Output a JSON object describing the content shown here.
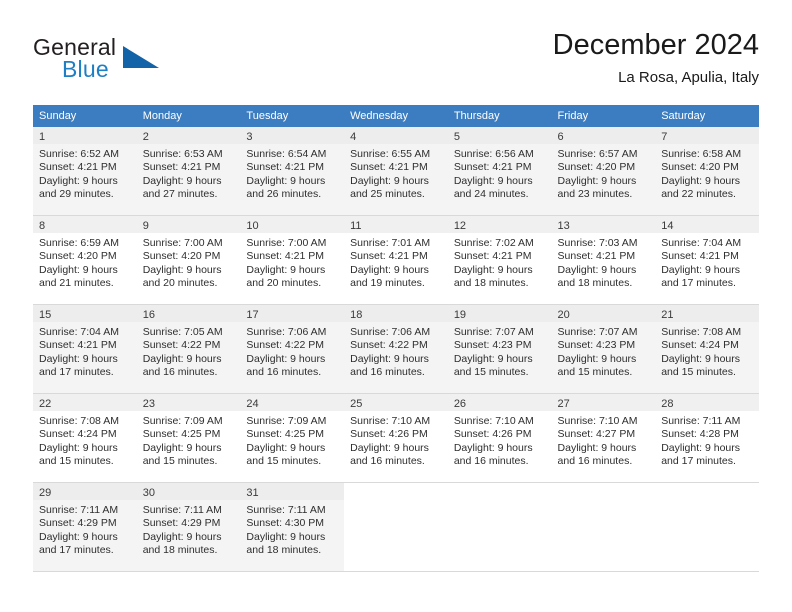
{
  "brand": {
    "name_part1": "General",
    "name_part2": "Blue",
    "logo_icon": "blue-triangle-logo"
  },
  "header": {
    "month_title": "December 2024",
    "location": "La Rosa, Apulia, Italy"
  },
  "colors": {
    "header_blue": "#3b7dc0",
    "brand_blue": "#1f7fc4",
    "row_shade": "#f4f4f4",
    "daynum_band": "#ededed",
    "grid_line": "#d9d9d9"
  },
  "weekday_headers": [
    "Sunday",
    "Monday",
    "Tuesday",
    "Wednesday",
    "Thursday",
    "Friday",
    "Saturday"
  ],
  "labels": {
    "sunrise_prefix": "Sunrise: ",
    "sunset_prefix": "Sunset: ",
    "daylight_prefix": "Daylight: "
  },
  "weeks": [
    {
      "shaded": true,
      "days": [
        {
          "day": "1",
          "sunrise": "Sunrise: 6:52 AM",
          "sunset": "Sunset: 4:21 PM",
          "daylight_line1": "Daylight: 9 hours",
          "daylight_line2": "and 29 minutes."
        },
        {
          "day": "2",
          "sunrise": "Sunrise: 6:53 AM",
          "sunset": "Sunset: 4:21 PM",
          "daylight_line1": "Daylight: 9 hours",
          "daylight_line2": "and 27 minutes."
        },
        {
          "day": "3",
          "sunrise": "Sunrise: 6:54 AM",
          "sunset": "Sunset: 4:21 PM",
          "daylight_line1": "Daylight: 9 hours",
          "daylight_line2": "and 26 minutes."
        },
        {
          "day": "4",
          "sunrise": "Sunrise: 6:55 AM",
          "sunset": "Sunset: 4:21 PM",
          "daylight_line1": "Daylight: 9 hours",
          "daylight_line2": "and 25 minutes."
        },
        {
          "day": "5",
          "sunrise": "Sunrise: 6:56 AM",
          "sunset": "Sunset: 4:21 PM",
          "daylight_line1": "Daylight: 9 hours",
          "daylight_line2": "and 24 minutes."
        },
        {
          "day": "6",
          "sunrise": "Sunrise: 6:57 AM",
          "sunset": "Sunset: 4:20 PM",
          "daylight_line1": "Daylight: 9 hours",
          "daylight_line2": "and 23 minutes."
        },
        {
          "day": "7",
          "sunrise": "Sunrise: 6:58 AM",
          "sunset": "Sunset: 4:20 PM",
          "daylight_line1": "Daylight: 9 hours",
          "daylight_line2": "and 22 minutes."
        }
      ]
    },
    {
      "shaded": false,
      "days": [
        {
          "day": "8",
          "sunrise": "Sunrise: 6:59 AM",
          "sunset": "Sunset: 4:20 PM",
          "daylight_line1": "Daylight: 9 hours",
          "daylight_line2": "and 21 minutes."
        },
        {
          "day": "9",
          "sunrise": "Sunrise: 7:00 AM",
          "sunset": "Sunset: 4:20 PM",
          "daylight_line1": "Daylight: 9 hours",
          "daylight_line2": "and 20 minutes."
        },
        {
          "day": "10",
          "sunrise": "Sunrise: 7:00 AM",
          "sunset": "Sunset: 4:21 PM",
          "daylight_line1": "Daylight: 9 hours",
          "daylight_line2": "and 20 minutes."
        },
        {
          "day": "11",
          "sunrise": "Sunrise: 7:01 AM",
          "sunset": "Sunset: 4:21 PM",
          "daylight_line1": "Daylight: 9 hours",
          "daylight_line2": "and 19 minutes."
        },
        {
          "day": "12",
          "sunrise": "Sunrise: 7:02 AM",
          "sunset": "Sunset: 4:21 PM",
          "daylight_line1": "Daylight: 9 hours",
          "daylight_line2": "and 18 minutes."
        },
        {
          "day": "13",
          "sunrise": "Sunrise: 7:03 AM",
          "sunset": "Sunset: 4:21 PM",
          "daylight_line1": "Daylight: 9 hours",
          "daylight_line2": "and 18 minutes."
        },
        {
          "day": "14",
          "sunrise": "Sunrise: 7:04 AM",
          "sunset": "Sunset: 4:21 PM",
          "daylight_line1": "Daylight: 9 hours",
          "daylight_line2": "and 17 minutes."
        }
      ]
    },
    {
      "shaded": true,
      "days": [
        {
          "day": "15",
          "sunrise": "Sunrise: 7:04 AM",
          "sunset": "Sunset: 4:21 PM",
          "daylight_line1": "Daylight: 9 hours",
          "daylight_line2": "and 17 minutes."
        },
        {
          "day": "16",
          "sunrise": "Sunrise: 7:05 AM",
          "sunset": "Sunset: 4:22 PM",
          "daylight_line1": "Daylight: 9 hours",
          "daylight_line2": "and 16 minutes."
        },
        {
          "day": "17",
          "sunrise": "Sunrise: 7:06 AM",
          "sunset": "Sunset: 4:22 PM",
          "daylight_line1": "Daylight: 9 hours",
          "daylight_line2": "and 16 minutes."
        },
        {
          "day": "18",
          "sunrise": "Sunrise: 7:06 AM",
          "sunset": "Sunset: 4:22 PM",
          "daylight_line1": "Daylight: 9 hours",
          "daylight_line2": "and 16 minutes."
        },
        {
          "day": "19",
          "sunrise": "Sunrise: 7:07 AM",
          "sunset": "Sunset: 4:23 PM",
          "daylight_line1": "Daylight: 9 hours",
          "daylight_line2": "and 15 minutes."
        },
        {
          "day": "20",
          "sunrise": "Sunrise: 7:07 AM",
          "sunset": "Sunset: 4:23 PM",
          "daylight_line1": "Daylight: 9 hours",
          "daylight_line2": "and 15 minutes."
        },
        {
          "day": "21",
          "sunrise": "Sunrise: 7:08 AM",
          "sunset": "Sunset: 4:24 PM",
          "daylight_line1": "Daylight: 9 hours",
          "daylight_line2": "and 15 minutes."
        }
      ]
    },
    {
      "shaded": false,
      "days": [
        {
          "day": "22",
          "sunrise": "Sunrise: 7:08 AM",
          "sunset": "Sunset: 4:24 PM",
          "daylight_line1": "Daylight: 9 hours",
          "daylight_line2": "and 15 minutes."
        },
        {
          "day": "23",
          "sunrise": "Sunrise: 7:09 AM",
          "sunset": "Sunset: 4:25 PM",
          "daylight_line1": "Daylight: 9 hours",
          "daylight_line2": "and 15 minutes."
        },
        {
          "day": "24",
          "sunrise": "Sunrise: 7:09 AM",
          "sunset": "Sunset: 4:25 PM",
          "daylight_line1": "Daylight: 9 hours",
          "daylight_line2": "and 15 minutes."
        },
        {
          "day": "25",
          "sunrise": "Sunrise: 7:10 AM",
          "sunset": "Sunset: 4:26 PM",
          "daylight_line1": "Daylight: 9 hours",
          "daylight_line2": "and 16 minutes."
        },
        {
          "day": "26",
          "sunrise": "Sunrise: 7:10 AM",
          "sunset": "Sunset: 4:26 PM",
          "daylight_line1": "Daylight: 9 hours",
          "daylight_line2": "and 16 minutes."
        },
        {
          "day": "27",
          "sunrise": "Sunrise: 7:10 AM",
          "sunset": "Sunset: 4:27 PM",
          "daylight_line1": "Daylight: 9 hours",
          "daylight_line2": "and 16 minutes."
        },
        {
          "day": "28",
          "sunrise": "Sunrise: 7:11 AM",
          "sunset": "Sunset: 4:28 PM",
          "daylight_line1": "Daylight: 9 hours",
          "daylight_line2": "and 17 minutes."
        }
      ]
    },
    {
      "shaded": true,
      "days": [
        {
          "day": "29",
          "sunrise": "Sunrise: 7:11 AM",
          "sunset": "Sunset: 4:29 PM",
          "daylight_line1": "Daylight: 9 hours",
          "daylight_line2": "and 17 minutes."
        },
        {
          "day": "30",
          "sunrise": "Sunrise: 7:11 AM",
          "sunset": "Sunset: 4:29 PM",
          "daylight_line1": "Daylight: 9 hours",
          "daylight_line2": "and 18 minutes."
        },
        {
          "day": "31",
          "sunrise": "Sunrise: 7:11 AM",
          "sunset": "Sunset: 4:30 PM",
          "daylight_line1": "Daylight: 9 hours",
          "daylight_line2": "and 18 minutes."
        },
        null,
        null,
        null,
        null
      ]
    }
  ]
}
